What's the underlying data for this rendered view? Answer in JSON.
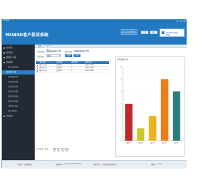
{
  "window": {
    "title": "MINI8D",
    "controls": [
      "–",
      "□",
      "×"
    ]
  },
  "header": {
    "app_title": "MINI8D客户投诉系统",
    "user_name": "admin(系统管理员)",
    "buttons": [
      "主页",
      "退出"
    ],
    "status_lines": [
      "2017年12月08日",
      "星期五"
    ]
  },
  "sidebar": {
    "items": [
      {
        "label": "投诉登记",
        "type": "group"
      },
      {
        "label": "投诉处理",
        "type": "group"
      },
      {
        "label": "数据统计分析",
        "type": "group"
      },
      {
        "label": "基础资料",
        "type": "group"
      },
      {
        "label": "客户投诉分析",
        "type": "sub"
      },
      {
        "label": "投诉统计分析",
        "type": "active"
      },
      {
        "label": "投诉类别分析",
        "type": "sub"
      },
      {
        "label": "投诉原因分析",
        "type": "sub"
      },
      {
        "label": "投诉责任分析",
        "type": "sub"
      },
      {
        "label": "投诉月份分析",
        "type": "sub"
      },
      {
        "label": "处理状态分析",
        "type": "sub"
      },
      {
        "label": "投诉产品分析",
        "type": "sub"
      },
      {
        "label": "责任部门分析",
        "type": "sub"
      },
      {
        "label": "客户满意度",
        "type": "sub"
      },
      {
        "label": "系统设置",
        "type": "group"
      }
    ]
  },
  "tabs": {
    "home": "首页",
    "active": "投诉统计"
  },
  "filters": {
    "row1_label": "开始日期",
    "row1_value": "2017-01-01",
    "row1b_label": "结束日期",
    "row1b_value": "2017-12-31",
    "row2_label": "统计类型",
    "row2_value": "按客户",
    "query_button": "查询",
    "export_button": "导出"
  },
  "table": {
    "columns": [
      "客户名称",
      "产品名称",
      "投诉数量",
      "投诉日期"
    ],
    "rows": [
      [
        "客户A公司",
        "产品001",
        "3",
        "2017-03-12"
      ],
      [
        "客户B公司",
        "产品002",
        "1",
        "2017-05-18"
      ],
      [
        "客户C公司",
        "产品003",
        "2",
        "2017-08-21"
      ]
    ]
  },
  "pager": {
    "text": "共 3 条 第 1/1 页",
    "first": "首页",
    "prev": "上页",
    "next": "下页",
    "last": "末页"
  },
  "chart_panel_title": "投诉数据统计图",
  "chart_data": {
    "type": "bar",
    "categories": [
      "客户A",
      "客户B",
      "客户C",
      "客户D",
      "客户E"
    ],
    "values": [
      3,
      1,
      2,
      5,
      4
    ],
    "colors": [
      "#c0282a",
      "#c8c829",
      "#f0b21b",
      "#f07b18",
      "#2a7d78"
    ],
    "ylim": [
      0,
      6
    ],
    "yticks": [
      "0",
      "1",
      "2",
      "3",
      "4",
      "5",
      "6"
    ],
    "title": "",
    "xlabel": "",
    "ylabel": ""
  },
  "statusbar": {
    "left_label": "当前用户:",
    "left_value": "系统管理员",
    "mid_label": "登录时间:",
    "mid_value": "2017-12-08 09:21:35",
    "right_label": "版权所有:",
    "right_value": "广州赫德软件有限公司",
    "version_label": "版本号:",
    "version_value": "V2.0"
  }
}
